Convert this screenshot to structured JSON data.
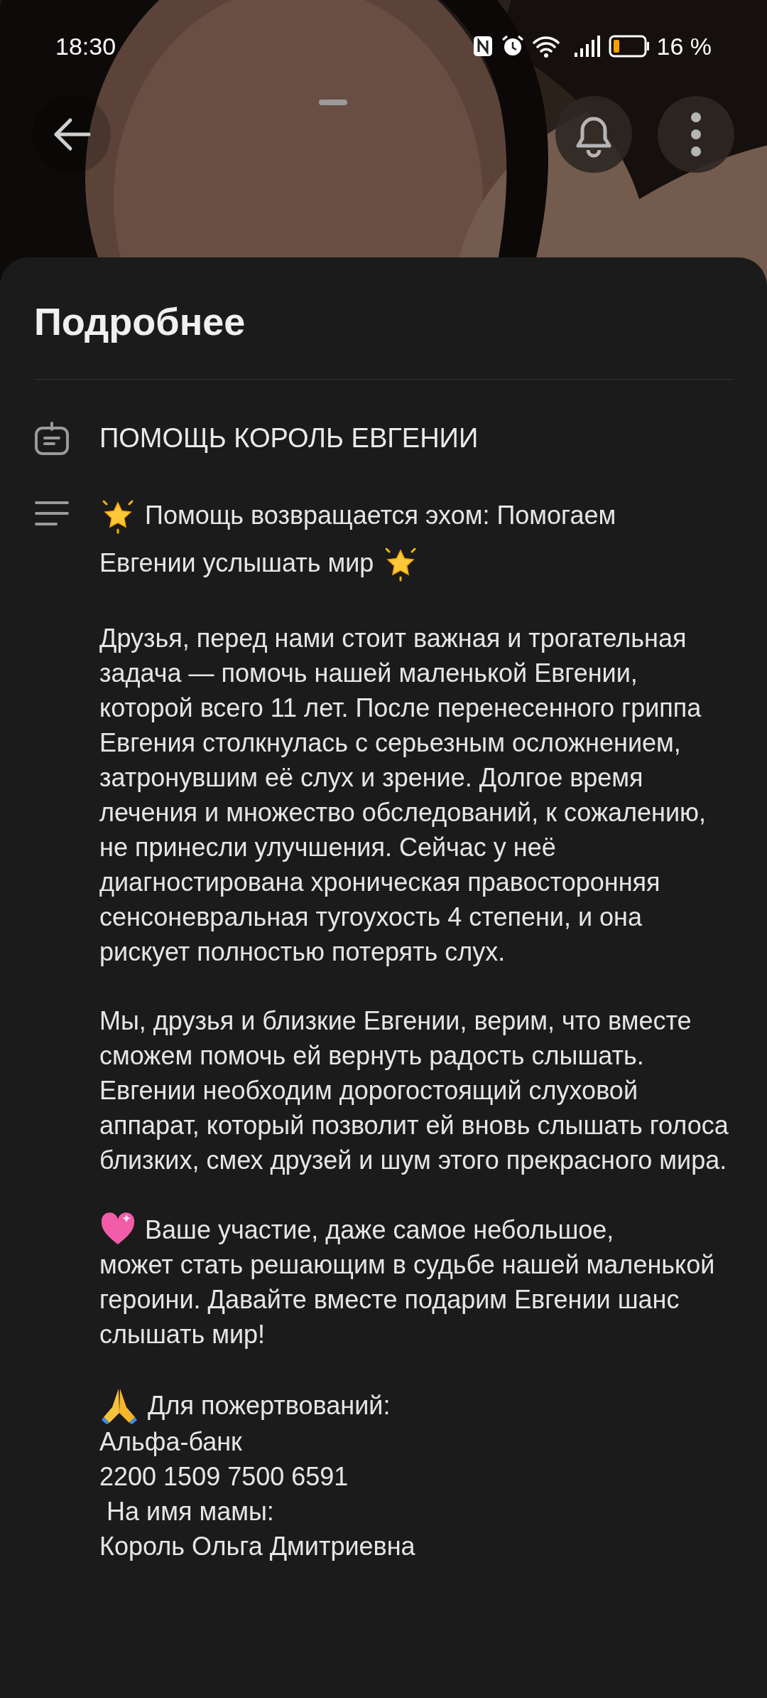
{
  "status_bar": {
    "time": "18:30",
    "battery_text": "16 %"
  },
  "sheet": {
    "title": "Подробнее",
    "name": "ПОМОЩЬ КОРОЛЬ ЕВГЕНИИ",
    "description": [
      {
        "kind": "stars",
        "text": "Помощь возвращается эхом: Помогаем",
        "continuation": "Евгении услышать мир"
      },
      {
        "kind": "plain",
        "text": "Друзья, перед нами стоит важная и трогательная задача — помочь нашей маленькой Евгении, которой всего 11 лет. После перенесенного гриппа Евгения столкнулась с серьезным осложнением, затронувшим её слух и зрение. Долгое время лечения и множество обследований, к сожалению, не принесли улучшения. Сейчас у неё диагностирована хроническая правосторонняя сенсоневральная тугоухость 4 степени, и она рискует полностью потерять слух."
      },
      {
        "kind": "plain",
        "text": "Мы, друзья и близкие Евгении, верим, что вместе сможем помочь ей вернуть радость слышать. Евгении необходим дорогостоящий слуховой аппарат, который позволит ей вновь слышать голоса близких, смех друзей и шум этого прекрасного мира."
      },
      {
        "kind": "heart",
        "text": "Ваше участие, даже самое небольшое,",
        "continuation": "может стать решающим в судьбе нашей маленькой героини. Давайте вместе подарим Евгении шанс слышать мир!"
      },
      {
        "kind": "pray",
        "text": "Для пожертвований:",
        "lines": [
          "Альфа-банк",
          "2200 1509 7500 6591",
          " На имя мамы:",
          "Король Ольга Дмитриевна"
        ]
      }
    ]
  }
}
